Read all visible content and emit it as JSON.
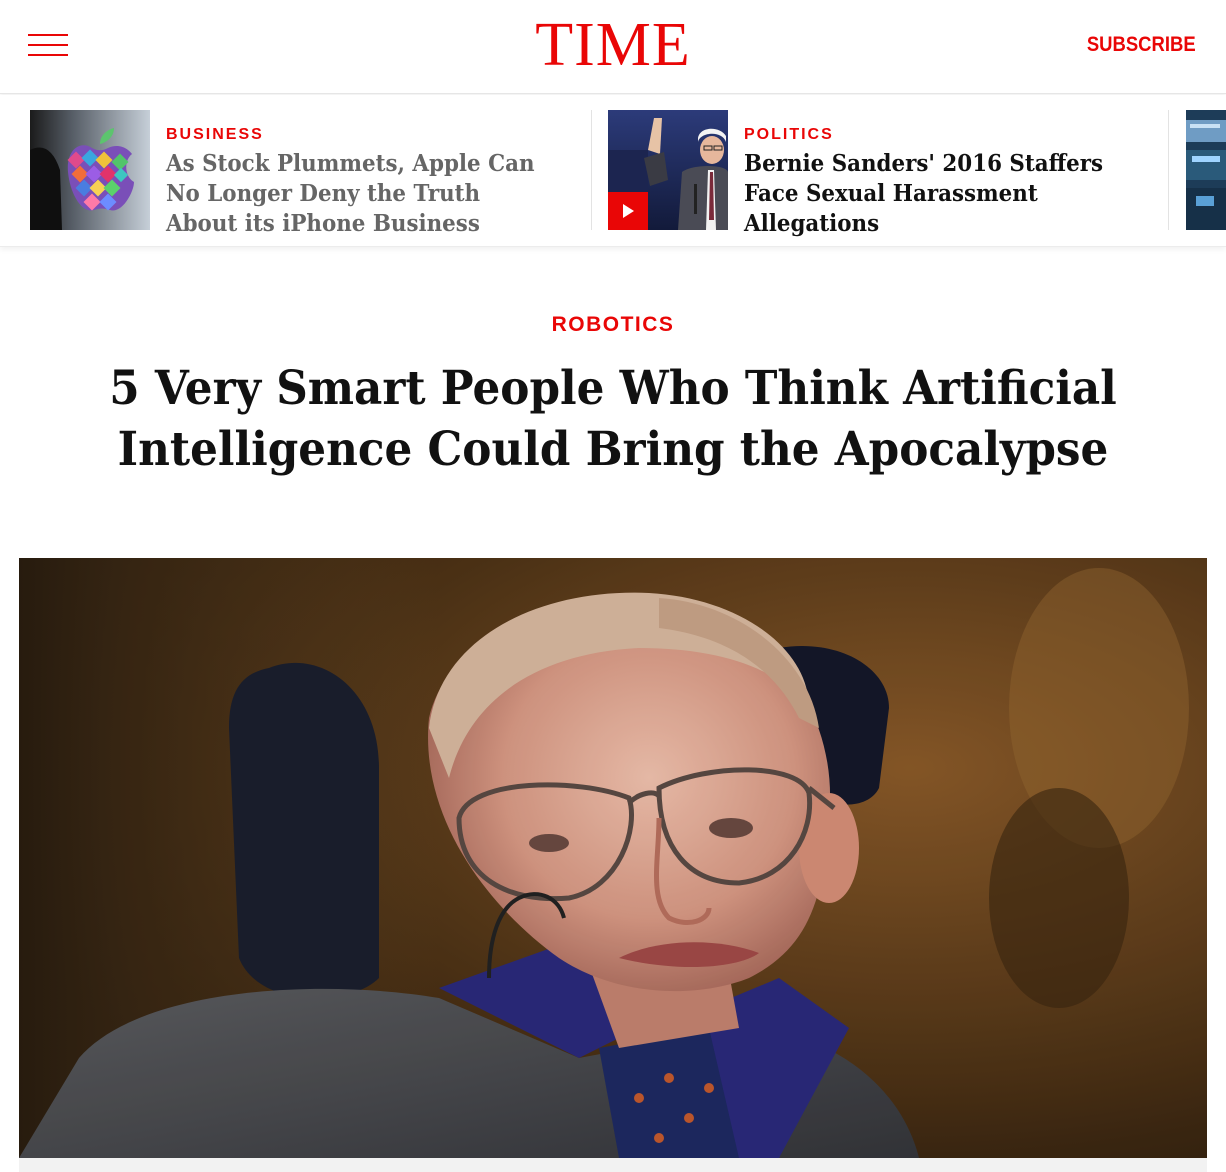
{
  "header": {
    "logo": "TIME",
    "subscribe_label": "SUBSCRIBE",
    "brand_color": "#e90606"
  },
  "trending": [
    {
      "kicker": "BUSINESS",
      "headline": "As Stock Plummets, Apple Can No Longer Deny the Truth About its iPhone Business",
      "thumb": "apple-logo-mosaic"
    },
    {
      "kicker": "POLITICS",
      "headline": "Bernie Sanders' 2016 Staffers Face Sexual Harassment Allegations",
      "thumb": "bernie-sanders-pointing",
      "has_video": true
    },
    {
      "kicker": "",
      "headline": "",
      "thumb": "stock-exchange-floor"
    }
  ],
  "article": {
    "section": "ROBOTICS",
    "title": "5 Very Smart People Who Think Artificial Intelligence Could Bring the Apocalypse",
    "hero_image": "stephen-hawking-portrait"
  }
}
